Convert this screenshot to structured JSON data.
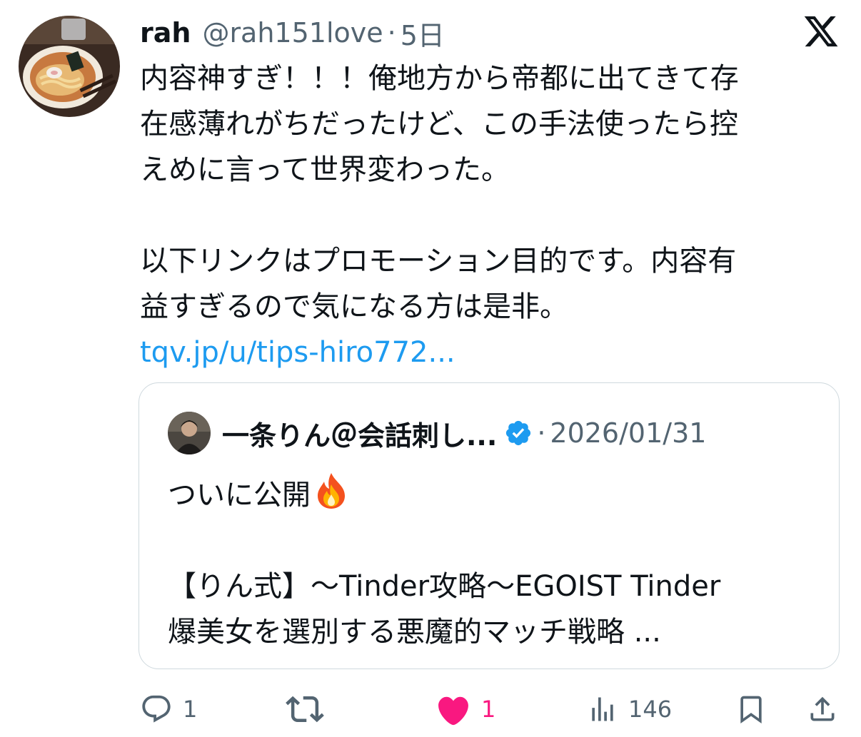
{
  "tweet": {
    "display_name": "rah",
    "handle": "@rah151love",
    "separator": "·",
    "time": "5日",
    "text_paragraph_1": "内容神すぎ！！！俺地方から帝都に出てきて存\n在感薄れがちだったけど、この手法使ったら控\nえめに言って世界変わった。",
    "text_paragraph_2": "以下リンクはプロモーション目的です。内容有\n益すぎるので気になる方は是非。",
    "link": "tqv.jp/u/tips-hiro772..."
  },
  "quoted_tweet": {
    "display_name": "一条りん＠会話刺し...",
    "separator": "·",
    "date": "2026/01/31",
    "line_1": "ついに公開",
    "line_2": "【りん式】〜Tinder攻略〜EGOIST Tinder",
    "line_3": "爆美女を選別する悪魔的マッチ戦略 ..."
  },
  "actions": {
    "reply_count": "1",
    "like_count": "1",
    "views_count": "146"
  },
  "colors": {
    "text": "#0f1419",
    "secondary": "#536471",
    "link": "#1d9bf0",
    "like": "#f91880",
    "verified": "#1d9bf0",
    "border": "#cfd9de"
  },
  "icons": [
    "x-logo-icon",
    "verified-badge-icon",
    "fire-emoji-icon",
    "reply-icon",
    "retweet-icon",
    "heart-icon",
    "views-icon",
    "bookmark-icon",
    "share-icon"
  ]
}
